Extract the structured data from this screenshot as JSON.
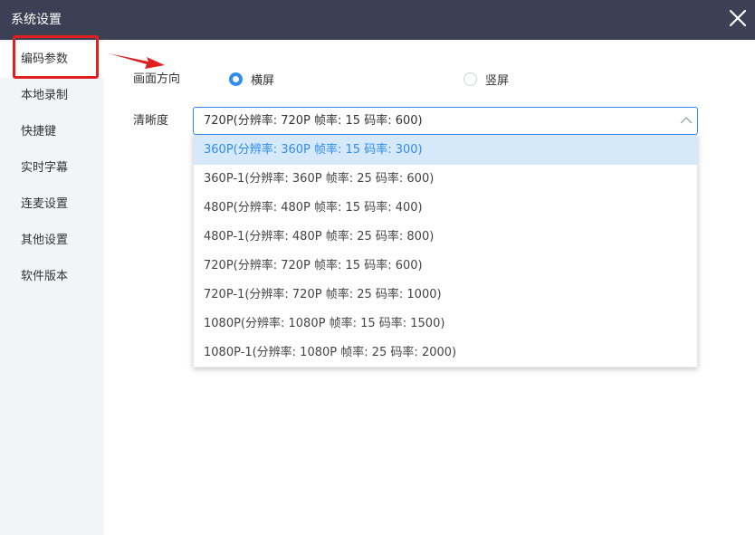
{
  "window": {
    "title": "系统设置",
    "close_icon": "close-icon"
  },
  "sidebar": {
    "items": [
      {
        "label": "编码参数",
        "active": true
      },
      {
        "label": "本地录制",
        "active": false
      },
      {
        "label": "快捷键",
        "active": false
      },
      {
        "label": "实时字幕",
        "active": false
      },
      {
        "label": "连麦设置",
        "active": false
      },
      {
        "label": "其他设置",
        "active": false
      },
      {
        "label": "软件版本",
        "active": false
      }
    ]
  },
  "orientation": {
    "label": "画面方向",
    "options": [
      {
        "label": "横屏",
        "checked": true
      },
      {
        "label": "竖屏",
        "checked": false
      }
    ]
  },
  "resolution": {
    "label": "清晰度",
    "selected_value": "720P(分辨率: 720P  帧率: 15 码率: 600)",
    "dropdown_open": true,
    "options": [
      {
        "label": "360P(分辨率: 360P  帧率: 15 码率: 300)",
        "highlighted": true
      },
      {
        "label": "360P-1(分辨率: 360P  帧率: 25 码率: 600)",
        "highlighted": false
      },
      {
        "label": "480P(分辨率: 480P  帧率: 15 码率: 400)",
        "highlighted": false
      },
      {
        "label": "480P-1(分辨率: 480P  帧率: 25 码率: 800)",
        "highlighted": false
      },
      {
        "label": "720P(分辨率: 720P  帧率: 15 码率: 600)",
        "highlighted": false
      },
      {
        "label": "720P-1(分辨率: 720P  帧率: 25 码率: 1000)",
        "highlighted": false
      },
      {
        "label": "1080P(分辨率: 1080P  帧率: 15 码率: 1500)",
        "highlighted": false
      },
      {
        "label": "1080P-1(分辨率: 1080P  帧率: 25 码率: 2000)",
        "highlighted": false
      }
    ]
  },
  "colors": {
    "titlebar": "#3c4054",
    "sidebar": "#f2f4f7",
    "accent": "#2f8df2",
    "annotation_red": "#e0201f",
    "highlight_bg": "#d6e9fb"
  }
}
